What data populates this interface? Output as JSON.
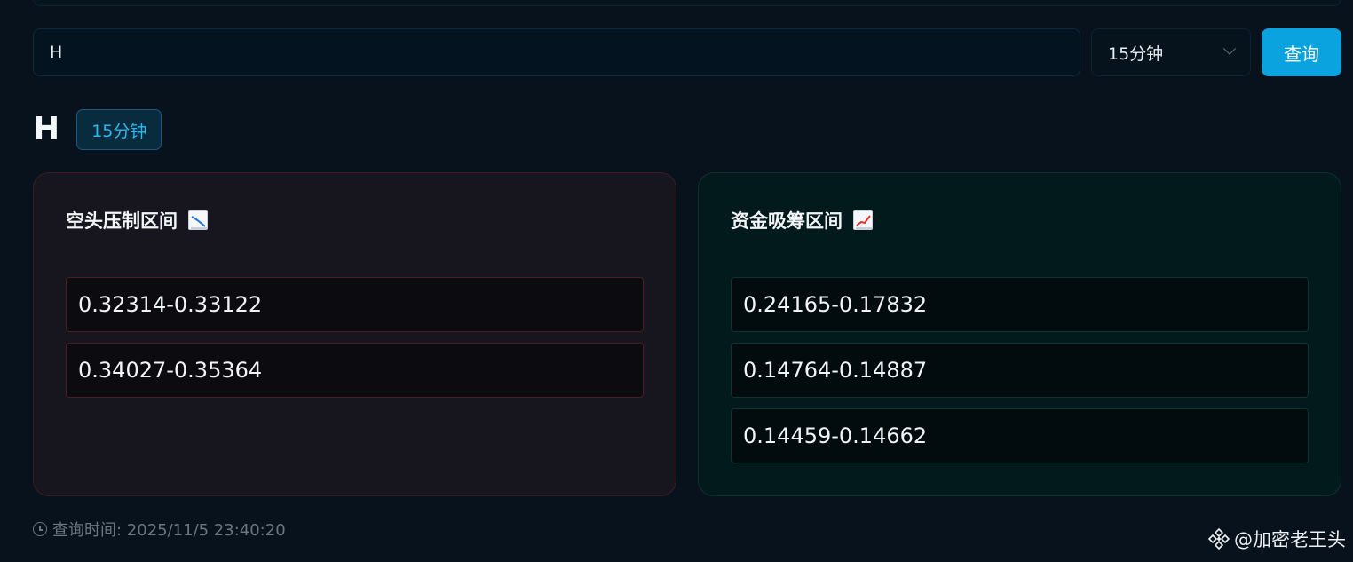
{
  "search": {
    "value": "H",
    "interval_selected": "15分钟",
    "query_label": "查询"
  },
  "result": {
    "symbol": "H",
    "interval_badge": "15分钟"
  },
  "bear_zone": {
    "title": "空头压制区间",
    "icon": "chart-decreasing-icon",
    "items": [
      "0.32314-0.33122",
      "0.34027-0.35364"
    ]
  },
  "bull_zone": {
    "title": "资金吸筹区间",
    "icon": "chart-increasing-icon",
    "items": [
      "0.24165-0.17832",
      "0.14764-0.14887",
      "0.14459-0.14662"
    ]
  },
  "footer": {
    "query_time": "查询时间: 2025/11/5 23:40:20"
  },
  "watermark": {
    "text": "@加密老王头",
    "icon": "binance-logo-icon"
  },
  "colors": {
    "background": "#07121c",
    "accent": "#0aa3df",
    "bear_border": "#4a1e21",
    "bull_border": "#0f3232"
  }
}
